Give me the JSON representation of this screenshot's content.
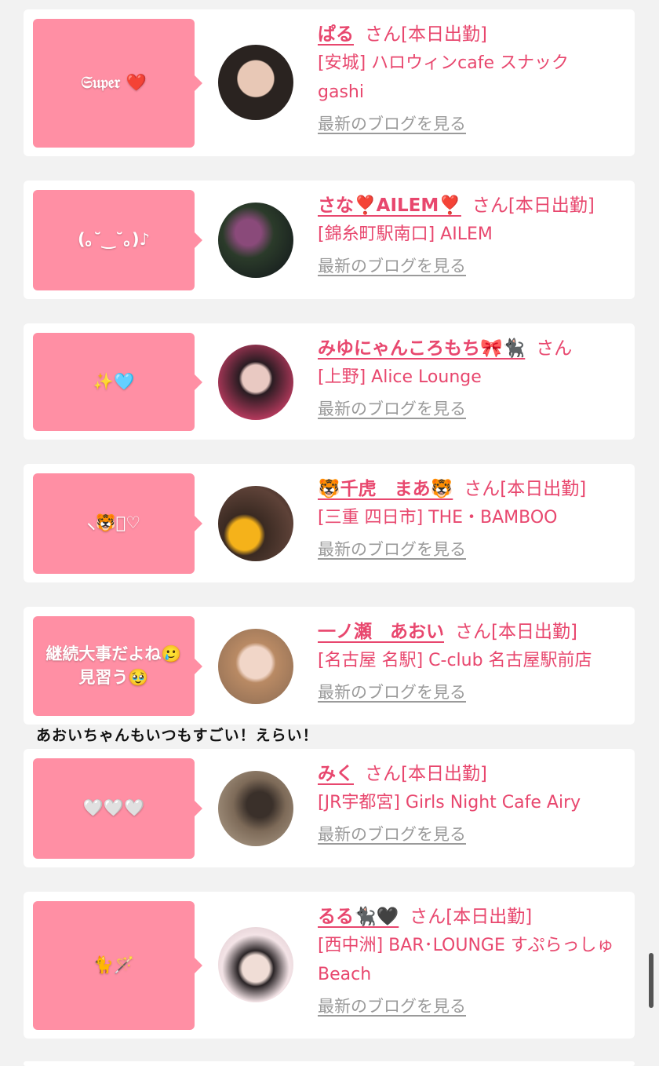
{
  "san_label": "さん",
  "duty_label": "[本日出勤]",
  "blog_link_label": "最新のブログを見る",
  "bubble_color": "#ff8fa4",
  "name_color": "#e8476e",
  "entries": [
    {
      "bubble_text": "𝔖𝔲𝔭𝔢𝔯 ❤️",
      "name": "ぱる",
      "on_duty": true,
      "shop": "[安城] ハロウィンcafe スナックgashi"
    },
    {
      "bubble_text": "(｡˘‿˘｡)♪",
      "name": "さな❣️AILEM❣️",
      "on_duty": true,
      "shop": "[錦糸町駅南口] AILEM"
    },
    {
      "bubble_text": "✨🩵",
      "name": "みゆにゃんころもち🎀🐈‍⬛",
      "on_duty": false,
      "shop": "[上野] Alice Lounge"
    },
    {
      "bubble_text": "⸜🐯⸝‍♡",
      "name": "🐯千虎　まあ🐯",
      "on_duty": true,
      "shop": "[三重 四日市] THE・BAMBOO"
    },
    {
      "bubble_text": "継続大事だよね🥲\n見習う🥹",
      "name": "一ノ瀬　あおい",
      "on_duty": true,
      "shop": "[名古屋 名駅] C-club 名古屋駅前店"
    },
    {
      "bubble_text": "🤍🤍🤍",
      "name": "みく",
      "on_duty": true,
      "shop": "[JR宇都宮] Girls Night Cafe Airy"
    },
    {
      "bubble_text": "🐈🪄",
      "name": "るる🐈‍⬛🖤",
      "on_duty": true,
      "shop": "[西中洲] BAR･LOUNGE すぷらっしゅBeach"
    }
  ],
  "overflow_comment": "あおいちゃんもいつもすごい！えらい！"
}
